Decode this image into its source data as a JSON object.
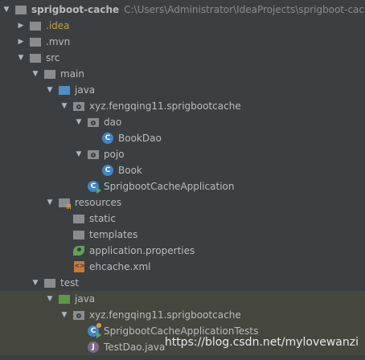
{
  "tree": [
    {
      "id": "root",
      "label": "sprigboot-cache",
      "path": "C:\\Users\\Administrator\\IdeaProjects\\sprigboot-cache",
      "indent": 0,
      "arrow": "open",
      "icon": "folder-grey",
      "bold": true
    },
    {
      "id": "idea",
      "label": ".idea",
      "indent": 1,
      "arrow": "closed",
      "icon": "folder-grey",
      "gold": true
    },
    {
      "id": "mvn",
      "label": ".mvn",
      "indent": 1,
      "arrow": "closed",
      "icon": "folder-grey"
    },
    {
      "id": "src",
      "label": "src",
      "indent": 1,
      "arrow": "open",
      "icon": "folder-grey"
    },
    {
      "id": "main",
      "label": "main",
      "indent": 2,
      "arrow": "open",
      "icon": "folder-grey"
    },
    {
      "id": "java",
      "label": "java",
      "indent": 3,
      "arrow": "open",
      "icon": "folder-blue"
    },
    {
      "id": "pkg-main",
      "label": "xyz.fengqing11.sprigbootcache",
      "indent": 4,
      "arrow": "open",
      "icon": "package"
    },
    {
      "id": "dao",
      "label": "dao",
      "indent": 5,
      "arrow": "open",
      "icon": "package"
    },
    {
      "id": "bookdao",
      "label": "BookDao",
      "indent": 6,
      "arrow": "none",
      "icon": "class"
    },
    {
      "id": "pojo",
      "label": "pojo",
      "indent": 5,
      "arrow": "open",
      "icon": "package"
    },
    {
      "id": "book",
      "label": "Book",
      "indent": 6,
      "arrow": "none",
      "icon": "class"
    },
    {
      "id": "app",
      "label": "SprigbootCacheApplication",
      "indent": 5,
      "arrow": "none",
      "icon": "spring-class"
    },
    {
      "id": "resources",
      "label": "resources",
      "indent": 3,
      "arrow": "open",
      "icon": "folder-resources"
    },
    {
      "id": "static",
      "label": "static",
      "indent": 4,
      "arrow": "none",
      "icon": "folder-grey"
    },
    {
      "id": "templates",
      "label": "templates",
      "indent": 4,
      "arrow": "none",
      "icon": "folder-grey"
    },
    {
      "id": "props",
      "label": "application.properties",
      "indent": 4,
      "arrow": "none",
      "icon": "properties"
    },
    {
      "id": "ehcache",
      "label": "ehcache.xml",
      "indent": 4,
      "arrow": "none",
      "icon": "xml"
    },
    {
      "id": "test",
      "label": "test",
      "indent": 2,
      "arrow": "open",
      "icon": "folder-grey"
    },
    {
      "id": "testjava",
      "label": "java",
      "indent": 3,
      "arrow": "open",
      "icon": "folder-green",
      "tinted": true
    },
    {
      "id": "pkg-test",
      "label": "xyz.fengqing11.sprigbootcache",
      "indent": 4,
      "arrow": "open",
      "icon": "package",
      "tinted": true
    },
    {
      "id": "apptests",
      "label": "SprigbootCacheApplicationTests",
      "indent": 5,
      "arrow": "none",
      "icon": "test-class",
      "tinted": true
    },
    {
      "id": "testdao",
      "label": "TestDao.java",
      "indent": 5,
      "arrow": "none",
      "icon": "java-file",
      "tinted": true
    }
  ],
  "watermark": "https://blog.csdn.net/mylovewanzi",
  "colors": {
    "background": "#3c3f41",
    "text": "#bbbbbb",
    "accent_blue": "#3f86c5",
    "tint": "#45473f"
  }
}
